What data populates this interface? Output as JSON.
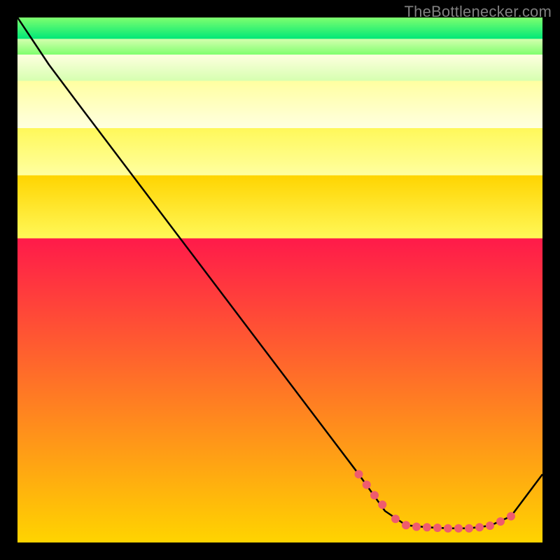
{
  "attribution": "TheBottlenecker.com",
  "chart_data": {
    "type": "line",
    "title": "",
    "xlabel": "",
    "ylabel": "",
    "xlim": [
      0,
      100
    ],
    "ylim": [
      0,
      100
    ],
    "curve": [
      {
        "x": 0,
        "y": 100
      },
      {
        "x": 6,
        "y": 91
      },
      {
        "x": 12,
        "y": 83
      },
      {
        "x": 65,
        "y": 13
      },
      {
        "x": 70,
        "y": 6
      },
      {
        "x": 74,
        "y": 3.3
      },
      {
        "x": 78,
        "y": 2.9
      },
      {
        "x": 82,
        "y": 2.7
      },
      {
        "x": 86,
        "y": 2.7
      },
      {
        "x": 90,
        "y": 3.2
      },
      {
        "x": 94,
        "y": 5
      },
      {
        "x": 100,
        "y": 13
      }
    ],
    "scatter": [
      {
        "x": 65,
        "y": 13
      },
      {
        "x": 66.5,
        "y": 11
      },
      {
        "x": 68,
        "y": 9
      },
      {
        "x": 69.5,
        "y": 7.2
      },
      {
        "x": 72,
        "y": 4.5
      },
      {
        "x": 74,
        "y": 3.3
      },
      {
        "x": 76,
        "y": 3.0
      },
      {
        "x": 78,
        "y": 2.9
      },
      {
        "x": 80,
        "y": 2.8
      },
      {
        "x": 82,
        "y": 2.7
      },
      {
        "x": 84,
        "y": 2.7
      },
      {
        "x": 86,
        "y": 2.7
      },
      {
        "x": 88,
        "y": 2.9
      },
      {
        "x": 90,
        "y": 3.2
      },
      {
        "x": 92,
        "y": 4.0
      },
      {
        "x": 94,
        "y": 5.0
      }
    ],
    "gradient_bands": [
      {
        "from": 0,
        "to": 58,
        "color_top": "#ff1a4a",
        "color_bot": "#ffd400"
      },
      {
        "from": 58,
        "to": 70,
        "color_top": "#ffd400",
        "color_bot": "#fff859"
      },
      {
        "from": 70,
        "to": 79,
        "color_top": "#fff859",
        "color_bot": "#ffffa0"
      },
      {
        "from": 79,
        "to": 88,
        "color_top": "#ffffa0",
        "color_bot": "#ffffe0"
      },
      {
        "from": 88,
        "to": 93,
        "color_top": "#ffffe0",
        "color_bot": "#d6ffb0"
      },
      {
        "from": 93,
        "to": 96,
        "color_top": "#d6ffb0",
        "color_bot": "#7fff6e"
      },
      {
        "from": 96,
        "to": 100,
        "color_top": "#7fff6e",
        "color_bot": "#00e878"
      }
    ],
    "colors": {
      "line": "#000000",
      "dot": "#ef5b6e",
      "bg": "#000000"
    }
  }
}
